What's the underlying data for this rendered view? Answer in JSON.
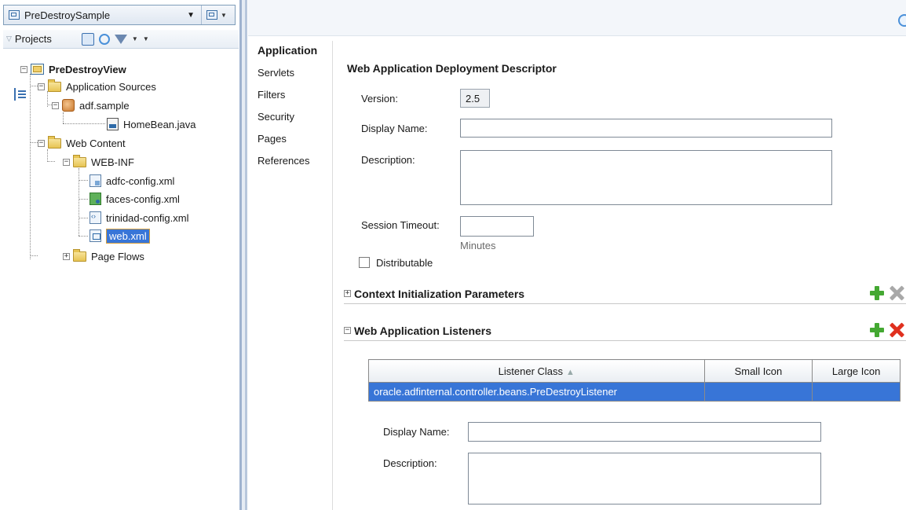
{
  "app": {
    "selected_application": "PreDestroySample"
  },
  "projects_panel": {
    "label": "Projects"
  },
  "tree": {
    "project": "PreDestroyView",
    "application_sources": "Application Sources",
    "package": "adf.sample",
    "java_file": "HomeBean.java",
    "web_content": "Web Content",
    "web_inf": "WEB-INF",
    "files": [
      "adfc-config.xml",
      "faces-config.xml",
      "trinidad-config.xml",
      "web.xml"
    ],
    "page_flows": "Page Flows"
  },
  "nav": {
    "items": [
      "Application",
      "Servlets",
      "Filters",
      "Security",
      "Pages",
      "References"
    ],
    "active": "Application"
  },
  "form": {
    "heading": "Web Application Deployment Descriptor",
    "version_label": "Version:",
    "version_value": "2.5",
    "display_name_label": "Display Name:",
    "display_name_value": "",
    "description_label": "Description:",
    "description_value": "",
    "session_timeout_label": "Session Timeout:",
    "session_timeout_value": "",
    "minutes_hint": "Minutes",
    "distributable_label": "Distributable",
    "distributable_checked": false
  },
  "sections": {
    "context_params": "Context Initialization Parameters",
    "listeners": "Web Application Listeners"
  },
  "listeners_table": {
    "columns": [
      "Listener Class",
      "Small Icon",
      "Large Icon"
    ],
    "rows": [
      {
        "listener_class": "oracle.adfinternal.controller.beans.PreDestroyListener",
        "small_icon": "",
        "large_icon": ""
      }
    ]
  },
  "listener_detail": {
    "display_name_label": "Display Name:",
    "display_name_value": "",
    "description_label": "Description:",
    "description_value": ""
  },
  "icons": {
    "add": "add-icon",
    "delete": "delete-icon",
    "help": "help-icon",
    "accent_selected": "#3875d7"
  }
}
